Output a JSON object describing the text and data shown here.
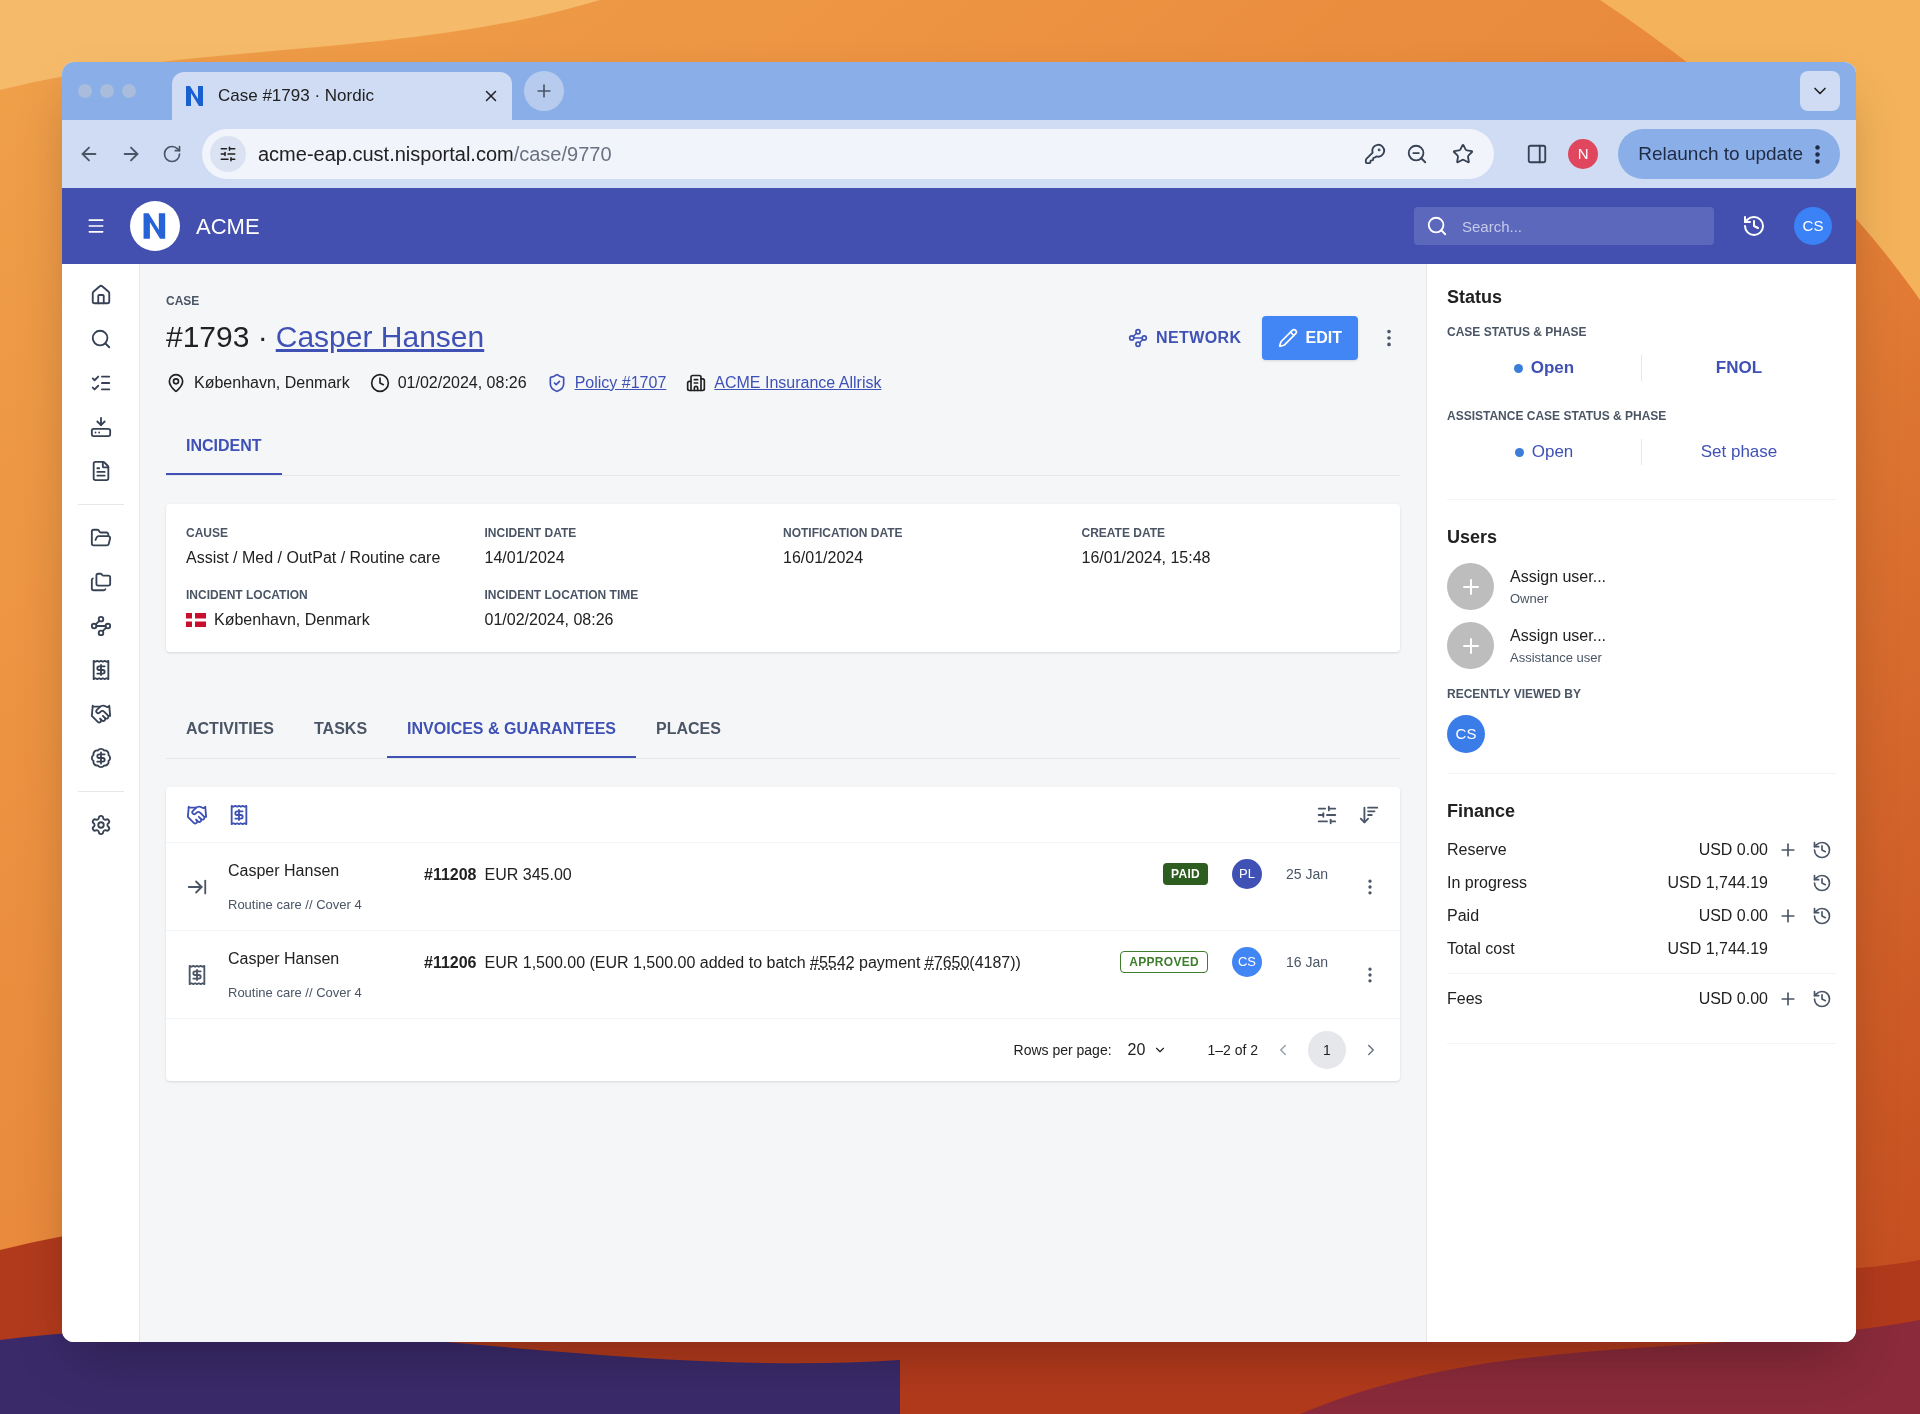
{
  "browser": {
    "tab_title": "Case #1793 · Nordic",
    "url_host": "acme-eap.cust.nisportal.com",
    "url_path": "/case/9770",
    "profile_initial": "N",
    "relaunch_label": "Relaunch to update"
  },
  "app": {
    "brand": "ACME",
    "search_placeholder": "Search...",
    "user_initials": "CS"
  },
  "case": {
    "label": "CASE",
    "number": "#1793 ·",
    "name": "Casper Hansen",
    "location": "København, Denmark",
    "datetime": "01/02/2024, 08:26",
    "policy": "Policy #1707",
    "insurer": "ACME Insurance Allrisk",
    "network_label": "NETWORK",
    "edit_label": "EDIT"
  },
  "top_tabs": [
    {
      "label": "INCIDENT",
      "selected": true
    }
  ],
  "incident": [
    {
      "label": "CAUSE",
      "value": "Assist / Med / OutPat / Routine care",
      "kind": "text"
    },
    {
      "label": "INCIDENT DATE",
      "value": "14/01/2024",
      "kind": "text"
    },
    {
      "label": "NOTIFICATION DATE",
      "value": "16/01/2024",
      "kind": "text"
    },
    {
      "label": "CREATE DATE",
      "value": "16/01/2024, 15:48",
      "kind": "text"
    },
    {
      "label": "INCIDENT LOCATION",
      "value": "København, Denmark",
      "kind": "country"
    },
    {
      "label": "INCIDENT LOCATION TIME",
      "value": "01/02/2024, 08:26",
      "kind": "text"
    }
  ],
  "sub_tabs": [
    {
      "label": "ACTIVITIES",
      "selected": false
    },
    {
      "label": "TASKS",
      "selected": false
    },
    {
      "label": "INVOICES & GUARANTEES",
      "selected": true
    },
    {
      "label": "PLACES",
      "selected": false
    }
  ],
  "invoices": [
    {
      "kind": "guarantee",
      "name": "Casper Hansen",
      "subtitle": "Routine care // Cover 4",
      "number": "#11208",
      "amount": [
        {
          "text": "EUR 345.00",
          "link": false
        }
      ],
      "status": {
        "label": "PAID",
        "kind": "paid"
      },
      "avatar": {
        "initials": "PL",
        "color": "#3f51b5"
      },
      "date": "25 Jan"
    },
    {
      "kind": "invoice",
      "name": "Casper Hansen",
      "subtitle": "Routine care // Cover 4",
      "number": "#11206",
      "amount": [
        {
          "text": "EUR 1,500.00 (EUR 1,500.00 added to batch ",
          "link": false
        },
        {
          "text": "#5542",
          "link": true
        },
        {
          "text": " payment ",
          "link": false
        },
        {
          "text": "#7650",
          "link": true
        },
        {
          "text": "(4187))",
          "link": false
        }
      ],
      "status": {
        "label": "APPROVED",
        "kind": "approved"
      },
      "avatar": {
        "initials": "CS",
        "color": "#4285f4"
      },
      "date": "16 Jan"
    }
  ],
  "pagination": {
    "rows_label": "Rows per page:",
    "rows_value": "20",
    "range": "1–2 of 2",
    "page": "1"
  },
  "status": {
    "title": "Status",
    "groups": [
      {
        "label": "CASE STATUS & PHASE",
        "status": "Open",
        "phase": "FNOL",
        "phase_set": true
      },
      {
        "label": "ASSISTANCE CASE STATUS & PHASE",
        "status": "Open",
        "phase": "Set phase",
        "phase_set": false
      }
    ]
  },
  "users": {
    "title": "Users",
    "items": [
      {
        "label": "Assign user...",
        "role": "Owner"
      },
      {
        "label": "Assign user...",
        "role": "Assistance user"
      }
    ],
    "recent_label": "RECENTLY VIEWED BY",
    "recent": [
      {
        "initials": "CS",
        "color": "#3b7de8"
      }
    ]
  },
  "finance": {
    "title": "Finance",
    "groups": [
      [
        {
          "label": "Reserve",
          "value": "USD 0.00",
          "addable": true,
          "history": true
        },
        {
          "label": "In progress",
          "value": "USD 1,744.19",
          "addable": false,
          "history": true
        },
        {
          "label": "Paid",
          "value": "USD 0.00",
          "addable": true,
          "history": true
        },
        {
          "label": "Total cost",
          "value": "USD 1,744.19",
          "addable": false,
          "history": false
        }
      ],
      [
        {
          "label": "Fees",
          "value": "USD 0.00",
          "addable": true,
          "history": true
        }
      ]
    ]
  }
}
